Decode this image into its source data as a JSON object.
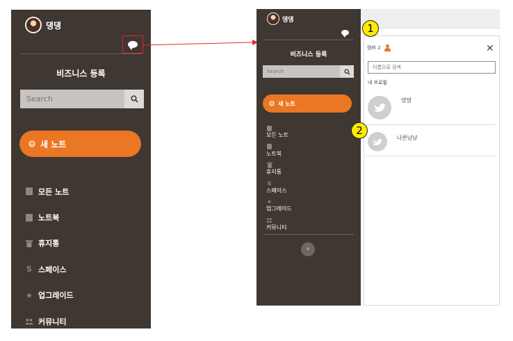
{
  "left_panel": {
    "user_name": "댕댕",
    "business_title": "비즈니스 등록",
    "search_placeholder": "Search",
    "new_note_label": "새 노트",
    "menu": [
      {
        "label": "모든 노트",
        "icon": "notes-icon"
      },
      {
        "label": "노트북",
        "icon": "notebook-icon"
      },
      {
        "label": "휴지통",
        "icon": "trash-icon"
      },
      {
        "label": "스페이스",
        "icon": "spaces-icon"
      },
      {
        "label": "업그레이드",
        "icon": "star-icon"
      },
      {
        "label": "커뮤니티",
        "icon": "people-icon"
      }
    ]
  },
  "right_panel": {
    "user_name": "댕댕",
    "business_title": "비즈니스 등록",
    "search_placeholder": "Search",
    "new_note_label": "새 노트",
    "menu": [
      {
        "label": "모든 노트",
        "icon": "notes-icon"
      },
      {
        "label": "노트북",
        "icon": "notebook-icon"
      },
      {
        "label": "휴지통",
        "icon": "trash-icon"
      },
      {
        "label": "스페이스",
        "icon": "spaces-icon"
      },
      {
        "label": "업그레이드",
        "icon": "star-icon"
      },
      {
        "label": "커뮤니티",
        "icon": "people-icon"
      }
    ],
    "collapse_symbol": "‹"
  },
  "member_panel": {
    "member_count_label": "멤버 2",
    "close_symbol": "✕",
    "name_search_placeholder": "이름으로 검색",
    "my_profile_label": "내 프로필",
    "profiles": [
      {
        "name": "댕댕"
      },
      {
        "name": "나른냥냥"
      }
    ]
  },
  "markers": [
    "1",
    "2"
  ],
  "colors": {
    "sidebar_bg": "#3f3731",
    "accent_orange": "#eb7623",
    "highlight_red": "#e0282a",
    "marker_yellow": "#ffea00"
  }
}
